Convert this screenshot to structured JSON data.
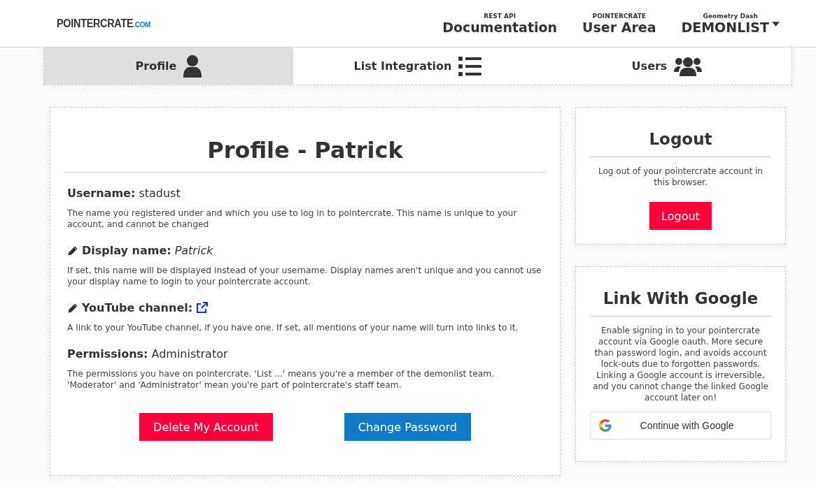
{
  "logo": {
    "name": "POINTERCRATE",
    "suffix": ".COM"
  },
  "nav": [
    {
      "caption": "REST API",
      "label": "Documentation",
      "dropdown": false
    },
    {
      "caption": "POINTERCRATE",
      "label": "User Area",
      "dropdown": false
    },
    {
      "caption": "Geometry Dash",
      "label": "DEMONLIST",
      "dropdown": true
    }
  ],
  "tabs": [
    {
      "label": "Profile",
      "selected": true
    },
    {
      "label": "List Integration",
      "selected": false
    },
    {
      "label": "Users",
      "selected": false
    }
  ],
  "profile": {
    "title": "Profile - Patrick",
    "fields": [
      {
        "label": "Username:",
        "value": "stadust",
        "editable": false,
        "kind": "plain",
        "description": "The name you registered under and which you use to log in to pointercrate. This name is unique to your account, and cannot be changed"
      },
      {
        "label": "Display name:",
        "value": "Patrick",
        "editable": true,
        "kind": "italic",
        "description": "If set, this name will be displayed instead of your username. Display names aren't unique and you cannot use your display name to login to your pointercrate account."
      },
      {
        "label": "YouTube channel:",
        "editable": true,
        "kind": "link",
        "description": "A link to your YouTube channel, if you have one. If set, all mentions of your name will turn into links to it."
      },
      {
        "label": "Permissions:",
        "value": "Administrator",
        "editable": false,
        "kind": "plain",
        "description": "The permissions you have on pointercrate. 'List ...' means you're a member of the demonlist team. 'Moderator' and 'Administrator' mean you're part of pointercrate's staff team."
      }
    ],
    "buttons": [
      {
        "label": "Delete My Account",
        "kind": "danger"
      },
      {
        "label": "Change Password",
        "kind": "primary"
      }
    ]
  },
  "logout": {
    "title": "Logout",
    "text": "Log out of your pointercrate account in this browser.",
    "button": "Logout"
  },
  "google": {
    "title": "Link With Google",
    "text": "Enable signing in to your pointercrate account via Google oauth. More secure than password login, and avoids account lock-outs due to forgotten passwords. Linking a Google account is irreversible, and you cannot change the linked Google account later on!",
    "button": "Continue with Google"
  }
}
